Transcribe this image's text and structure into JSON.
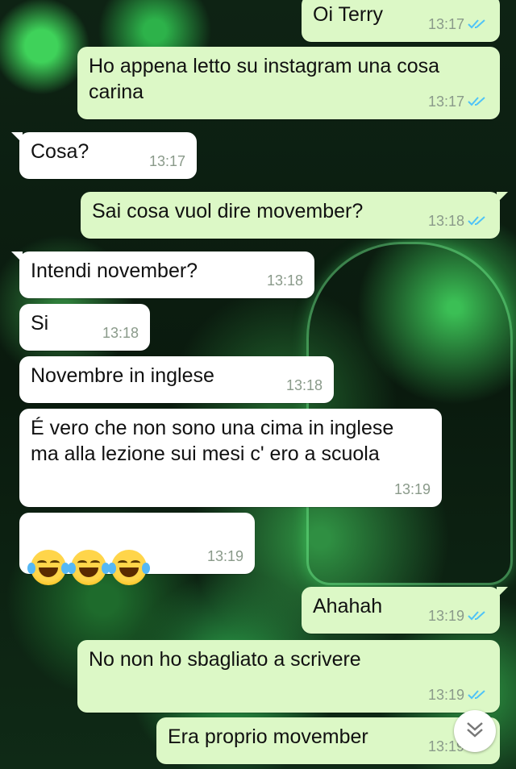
{
  "messages": [
    {
      "dir": "out",
      "text": "Oi Terry",
      "time": "13:17",
      "read": true
    },
    {
      "dir": "out",
      "text": "Ho appena letto su instagram una cosa\ncarina",
      "time": "13:17",
      "read": true
    },
    {
      "dir": "in",
      "text": "Cosa?",
      "time": "13:17"
    },
    {
      "dir": "out",
      "text": "Sai cosa vuol dire movember?",
      "time": "13:18",
      "read": true
    },
    {
      "dir": "in",
      "text": "Intendi november?",
      "time": "13:18"
    },
    {
      "dir": "in",
      "text": "Si",
      "time": "13:18"
    },
    {
      "dir": "in",
      "text": "Novembre in inglese",
      "time": "13:18"
    },
    {
      "dir": "in",
      "text": "É vero che non sono una cima in inglese\nma alla lezione sui mesi c' ero a scuola",
      "time": "13:19"
    },
    {
      "dir": "in",
      "text": "",
      "emoji": [
        "face-with-tears-of-joy",
        "face-with-tears-of-joy",
        "face-with-tears-of-joy"
      ],
      "time": "13:19"
    },
    {
      "dir": "out",
      "text": "Ahahah",
      "time": "13:19",
      "read": true
    },
    {
      "dir": "out",
      "text": "No non ho sbagliato a scrivere",
      "time": "13:19",
      "read": true
    },
    {
      "dir": "out",
      "text": "Era proprio movember",
      "time": "13:19",
      "read": true
    }
  ],
  "colors": {
    "outgoing": "#dcf8c6",
    "incoming": "#ffffff",
    "read_ticks": "#4fc3f7",
    "time": "#8a9a8a"
  },
  "scroll_button": {
    "icon": "double-chevron-down-icon"
  }
}
